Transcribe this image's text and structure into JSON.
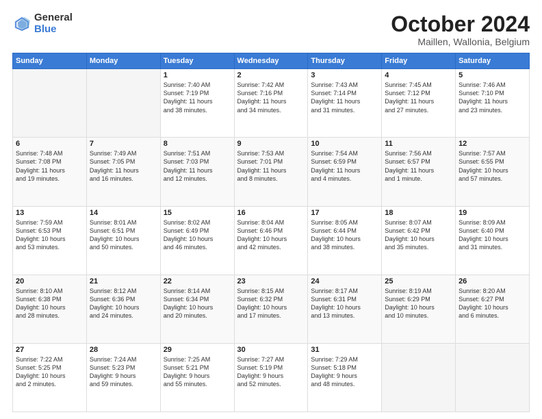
{
  "header": {
    "logo_general": "General",
    "logo_blue": "Blue",
    "title": "October 2024",
    "subtitle": "Maillen, Wallonia, Belgium"
  },
  "days_of_week": [
    "Sunday",
    "Monday",
    "Tuesday",
    "Wednesday",
    "Thursday",
    "Friday",
    "Saturday"
  ],
  "weeks": [
    [
      {
        "day": "",
        "info": ""
      },
      {
        "day": "",
        "info": ""
      },
      {
        "day": "1",
        "info": "Sunrise: 7:40 AM\nSunset: 7:19 PM\nDaylight: 11 hours\nand 38 minutes."
      },
      {
        "day": "2",
        "info": "Sunrise: 7:42 AM\nSunset: 7:16 PM\nDaylight: 11 hours\nand 34 minutes."
      },
      {
        "day": "3",
        "info": "Sunrise: 7:43 AM\nSunset: 7:14 PM\nDaylight: 11 hours\nand 31 minutes."
      },
      {
        "day": "4",
        "info": "Sunrise: 7:45 AM\nSunset: 7:12 PM\nDaylight: 11 hours\nand 27 minutes."
      },
      {
        "day": "5",
        "info": "Sunrise: 7:46 AM\nSunset: 7:10 PM\nDaylight: 11 hours\nand 23 minutes."
      }
    ],
    [
      {
        "day": "6",
        "info": "Sunrise: 7:48 AM\nSunset: 7:08 PM\nDaylight: 11 hours\nand 19 minutes."
      },
      {
        "day": "7",
        "info": "Sunrise: 7:49 AM\nSunset: 7:05 PM\nDaylight: 11 hours\nand 16 minutes."
      },
      {
        "day": "8",
        "info": "Sunrise: 7:51 AM\nSunset: 7:03 PM\nDaylight: 11 hours\nand 12 minutes."
      },
      {
        "day": "9",
        "info": "Sunrise: 7:53 AM\nSunset: 7:01 PM\nDaylight: 11 hours\nand 8 minutes."
      },
      {
        "day": "10",
        "info": "Sunrise: 7:54 AM\nSunset: 6:59 PM\nDaylight: 11 hours\nand 4 minutes."
      },
      {
        "day": "11",
        "info": "Sunrise: 7:56 AM\nSunset: 6:57 PM\nDaylight: 11 hours\nand 1 minute."
      },
      {
        "day": "12",
        "info": "Sunrise: 7:57 AM\nSunset: 6:55 PM\nDaylight: 10 hours\nand 57 minutes."
      }
    ],
    [
      {
        "day": "13",
        "info": "Sunrise: 7:59 AM\nSunset: 6:53 PM\nDaylight: 10 hours\nand 53 minutes."
      },
      {
        "day": "14",
        "info": "Sunrise: 8:01 AM\nSunset: 6:51 PM\nDaylight: 10 hours\nand 50 minutes."
      },
      {
        "day": "15",
        "info": "Sunrise: 8:02 AM\nSunset: 6:49 PM\nDaylight: 10 hours\nand 46 minutes."
      },
      {
        "day": "16",
        "info": "Sunrise: 8:04 AM\nSunset: 6:46 PM\nDaylight: 10 hours\nand 42 minutes."
      },
      {
        "day": "17",
        "info": "Sunrise: 8:05 AM\nSunset: 6:44 PM\nDaylight: 10 hours\nand 38 minutes."
      },
      {
        "day": "18",
        "info": "Sunrise: 8:07 AM\nSunset: 6:42 PM\nDaylight: 10 hours\nand 35 minutes."
      },
      {
        "day": "19",
        "info": "Sunrise: 8:09 AM\nSunset: 6:40 PM\nDaylight: 10 hours\nand 31 minutes."
      }
    ],
    [
      {
        "day": "20",
        "info": "Sunrise: 8:10 AM\nSunset: 6:38 PM\nDaylight: 10 hours\nand 28 minutes."
      },
      {
        "day": "21",
        "info": "Sunrise: 8:12 AM\nSunset: 6:36 PM\nDaylight: 10 hours\nand 24 minutes."
      },
      {
        "day": "22",
        "info": "Sunrise: 8:14 AM\nSunset: 6:34 PM\nDaylight: 10 hours\nand 20 minutes."
      },
      {
        "day": "23",
        "info": "Sunrise: 8:15 AM\nSunset: 6:32 PM\nDaylight: 10 hours\nand 17 minutes."
      },
      {
        "day": "24",
        "info": "Sunrise: 8:17 AM\nSunset: 6:31 PM\nDaylight: 10 hours\nand 13 minutes."
      },
      {
        "day": "25",
        "info": "Sunrise: 8:19 AM\nSunset: 6:29 PM\nDaylight: 10 hours\nand 10 minutes."
      },
      {
        "day": "26",
        "info": "Sunrise: 8:20 AM\nSunset: 6:27 PM\nDaylight: 10 hours\nand 6 minutes."
      }
    ],
    [
      {
        "day": "27",
        "info": "Sunrise: 7:22 AM\nSunset: 5:25 PM\nDaylight: 10 hours\nand 2 minutes."
      },
      {
        "day": "28",
        "info": "Sunrise: 7:24 AM\nSunset: 5:23 PM\nDaylight: 9 hours\nand 59 minutes."
      },
      {
        "day": "29",
        "info": "Sunrise: 7:25 AM\nSunset: 5:21 PM\nDaylight: 9 hours\nand 55 minutes."
      },
      {
        "day": "30",
        "info": "Sunrise: 7:27 AM\nSunset: 5:19 PM\nDaylight: 9 hours\nand 52 minutes."
      },
      {
        "day": "31",
        "info": "Sunrise: 7:29 AM\nSunset: 5:18 PM\nDaylight: 9 hours\nand 48 minutes."
      },
      {
        "day": "",
        "info": ""
      },
      {
        "day": "",
        "info": ""
      }
    ]
  ]
}
